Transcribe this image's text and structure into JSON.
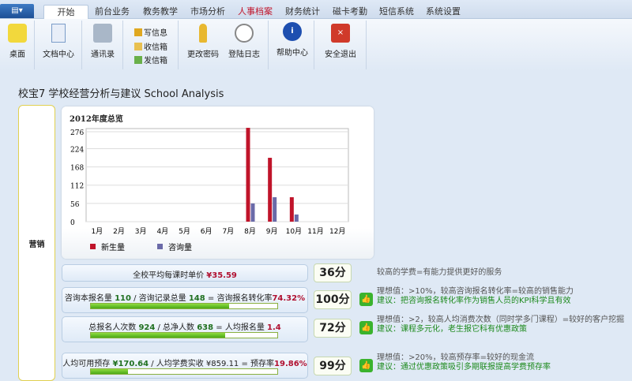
{
  "tabs": [
    "开始",
    "前台业务",
    "教务教学",
    "市场分析",
    "人事档案",
    "财务统计",
    "磁卡考勤",
    "短信系统",
    "系统设置"
  ],
  "app_menu_icon": "menu-icon",
  "ribbon": {
    "desktop": "桌面",
    "docs": "文档中心",
    "contacts": "通讯录",
    "write": "写信息",
    "inbox": "收信箱",
    "outbox": "发信箱",
    "password": "更改密码",
    "login_log": "登陆日志",
    "help": "帮助中心",
    "logout": "安全退出"
  },
  "page_title": "校宝7 学校经营分析与建议 School Analysis",
  "section_label": "营销",
  "chart_data": {
    "type": "bar",
    "title": "2012年度总览",
    "categories": [
      "1月",
      "2月",
      "3月",
      "4月",
      "5月",
      "6月",
      "7月",
      "8月",
      "9月",
      "10月",
      "11月",
      "12月"
    ],
    "yticks": [
      "0",
      "56",
      "112",
      "168",
      "224",
      "276"
    ],
    "ylim": [
      0,
      276
    ],
    "grid": true,
    "legend": "bottom-left",
    "series": [
      {
        "name": "新生量",
        "color": "#c0142a",
        "values": [
          0,
          0,
          0,
          0,
          0,
          0,
          0,
          288,
          196,
          75,
          0,
          0
        ]
      },
      {
        "name": "咨询量",
        "color": "#6a6aa8",
        "values": [
          0,
          0,
          0,
          0,
          0,
          0,
          0,
          56,
          75,
          22,
          0,
          0
        ]
      }
    ]
  },
  "metrics": [
    {
      "parts": [
        [
          "全校平均每课时单价 ",
          ""
        ],
        [
          "¥35.59",
          "r"
        ]
      ],
      "score": "36分",
      "tip": "较高的学费=有能力提供更好的服务",
      "suggest": "",
      "progress": null
    },
    {
      "parts": [
        [
          "咨询本报名量 ",
          ""
        ],
        [
          "110",
          "g"
        ],
        [
          " / 咨询记录总量 ",
          ""
        ],
        [
          "148",
          "g"
        ],
        [
          " = 咨询报名转化率",
          ""
        ],
        [
          "74.32%",
          "r"
        ]
      ],
      "score": "100分",
      "tip": "理想值：>10%，较高咨询报名转化率=较高的销售能力",
      "suggest": "建议：把咨询报名转化率作为销售人员的KPI科学且有效",
      "progress": 74.32
    },
    {
      "parts": [
        [
          "总报名人次数 ",
          ""
        ],
        [
          "924",
          "g"
        ],
        [
          " / 总净人数 ",
          ""
        ],
        [
          "638",
          "g"
        ],
        [
          " = 人均报名量 ",
          ""
        ],
        [
          "1.4",
          "r"
        ]
      ],
      "score": "72分",
      "tip": "理想值：>2，较高人均消费次数（同时学多门课程）=较好的客户挖掘",
      "suggest": "建议：课程多元化，老生报它科有优惠政策",
      "progress": 72
    },
    {
      "parts": [
        [
          "人均可用预存 ",
          ""
        ],
        [
          "¥170.64",
          "g"
        ],
        [
          " / 人均学费实收 ¥859.11 = 预存率",
          ""
        ],
        [
          "19.86%",
          "r"
        ]
      ],
      "score": "99分",
      "tip": "理想值：>20%，较高预存率=较好的现金流",
      "suggest": "建议：通过优惠政策吸引多期联报提高学费预存率",
      "progress": 19.86
    }
  ]
}
